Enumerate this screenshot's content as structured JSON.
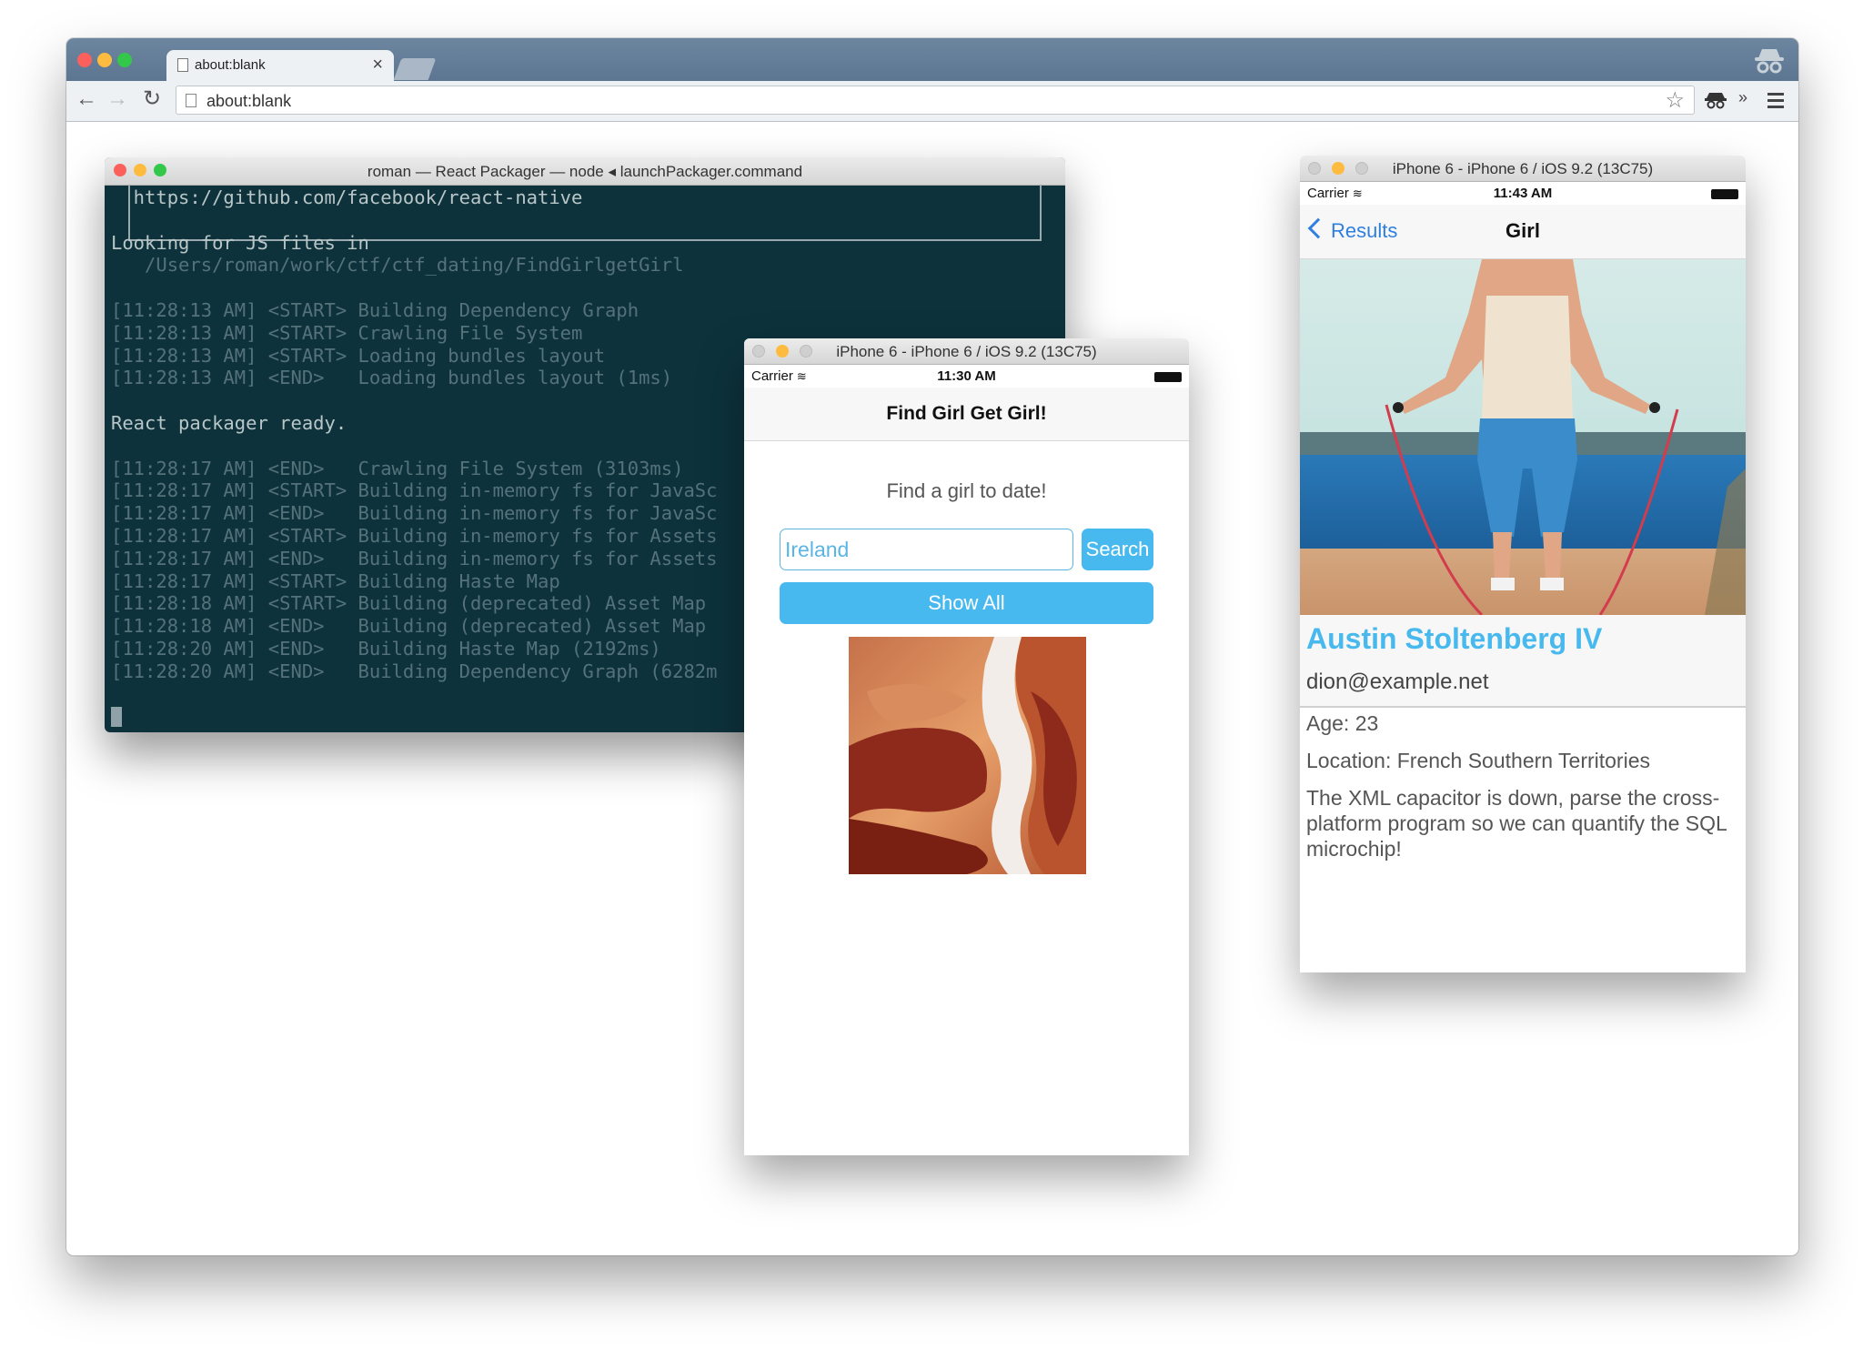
{
  "browser": {
    "tab_title": "about:blank",
    "tab_close": "×",
    "url": "about:blank",
    "chevrons": "»",
    "back_glyph": "←",
    "forward_glyph": "→",
    "reload_glyph": "↻",
    "star_glyph": "☆"
  },
  "terminal": {
    "title": "roman — React Packager — node ◂ launchPackager.command",
    "lines": [
      {
        "text": "  https://github.com/facebook/react-native",
        "style": "bright"
      },
      {
        "text": "",
        "style": "bright"
      },
      {
        "text": "Looking for JS files in",
        "style": "bright"
      },
      {
        "text": "   /Users/roman/work/ctf/ctf_dating/FindGirlgetGirl",
        "style": "dim"
      },
      {
        "text": "",
        "style": "dim"
      },
      {
        "text": "[11:28:13 AM] <START> Building Dependency Graph",
        "style": "dim"
      },
      {
        "text": "[11:28:13 AM] <START> Crawling File System",
        "style": "dim"
      },
      {
        "text": "[11:28:13 AM] <START> Loading bundles layout",
        "style": "dim"
      },
      {
        "text": "[11:28:13 AM] <END>   Loading bundles layout (1ms)",
        "style": "dim"
      },
      {
        "text": "",
        "style": "dim"
      },
      {
        "text": "React packager ready.",
        "style": "bright"
      },
      {
        "text": "",
        "style": "dim"
      },
      {
        "text": "[11:28:17 AM] <END>   Crawling File System (3103ms)",
        "style": "dim"
      },
      {
        "text": "[11:28:17 AM] <START> Building in-memory fs for JavaSc",
        "style": "dim"
      },
      {
        "text": "[11:28:17 AM] <END>   Building in-memory fs for JavaSc",
        "style": "dim"
      },
      {
        "text": "[11:28:17 AM] <START> Building in-memory fs for Assets",
        "style": "dim"
      },
      {
        "text": "[11:28:17 AM] <END>   Building in-memory fs for Assets",
        "style": "dim"
      },
      {
        "text": "[11:28:17 AM] <START> Building Haste Map",
        "style": "dim"
      },
      {
        "text": "[11:28:18 AM] <START> Building (deprecated) Asset Map",
        "style": "dim"
      },
      {
        "text": "[11:28:18 AM] <END>   Building (deprecated) Asset Map",
        "style": "dim"
      },
      {
        "text": "[11:28:20 AM] <END>   Building Haste Map (2192ms)",
        "style": "dim"
      },
      {
        "text": "[11:28:20 AM] <END>   Building Dependency Graph (6282m",
        "style": "dim"
      }
    ]
  },
  "phone1": {
    "window_title": "iPhone 6 - iPhone 6 / iOS 9.2 (13C75)",
    "carrier": "Carrier",
    "wifi_glyph": "≋",
    "time": "11:30 AM",
    "nav_title": "Find Girl Get Girl!",
    "prompt": "Find a girl to date!",
    "search_value": "Ireland",
    "search_label": "Search",
    "show_all_label": "Show All"
  },
  "phone2": {
    "window_title": "iPhone 6 - iPhone 6 / iOS 9.2 (13C75)",
    "carrier": "Carrier",
    "wifi_glyph": "≋",
    "time": "11:43 AM",
    "back_label": "Results",
    "nav_title": "Girl",
    "name": "Austin Stoltenberg IV",
    "email": "dion@example.net",
    "age": "Age: 23",
    "location": "Location: French Southern Territories",
    "description": "The XML capacitor is down, parse the cross-platform program so we can quantify the SQL microchip!"
  },
  "colors": {
    "accent": "#48b9ee",
    "terminal_bg": "#0d323c",
    "ios_blue": "#2f7fe0"
  }
}
